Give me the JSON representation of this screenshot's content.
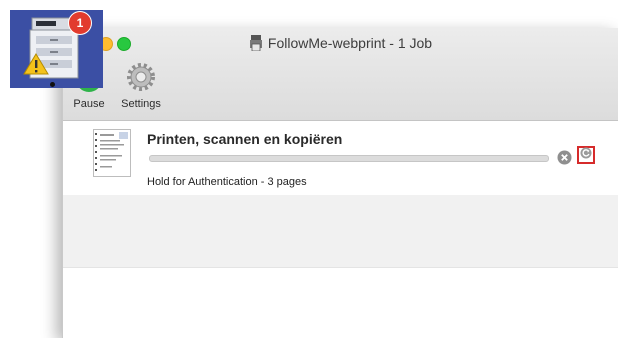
{
  "window": {
    "title": "FollowMe-webprint - 1 Job"
  },
  "toolbar": {
    "pause_label": "Pause",
    "settings_label": "Settings"
  },
  "job": {
    "name": "Printen, scannen en kopiëren",
    "status": "Hold for Authentication - 3 pages",
    "progress": 0
  },
  "dock": {
    "badge_count": "1"
  },
  "icons": {
    "title": "printer-icon",
    "pause": "pause-icon",
    "settings": "gear-icon",
    "document": "document-thumbnail-icon",
    "cancel": "cancel-icon",
    "resume": "resume-icon",
    "warning": "warning-icon"
  },
  "colors": {
    "dock_tile": "#3b4fa4",
    "badge": "#e23b2e",
    "highlight_border": "#d62b2b",
    "pause_green": "#28c840"
  }
}
